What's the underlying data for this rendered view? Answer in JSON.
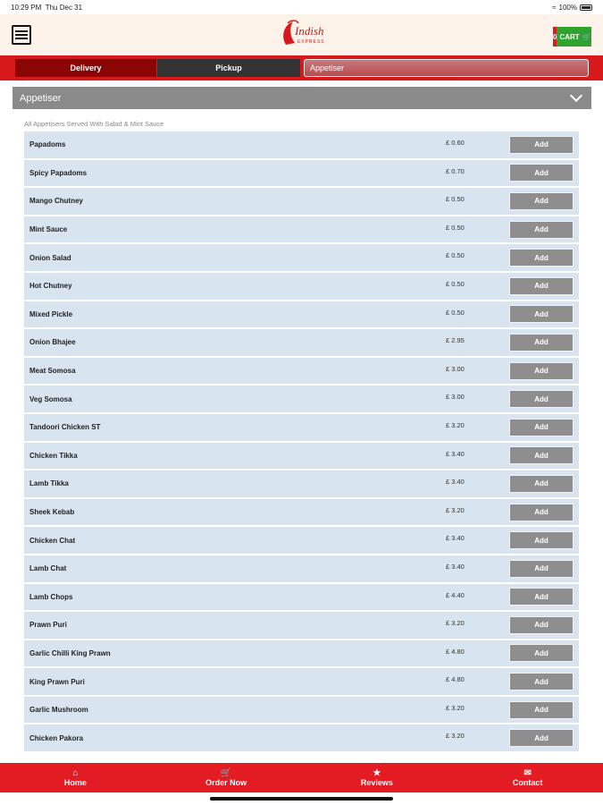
{
  "status_bar": {
    "time": "10:29 PM",
    "date": "Thu Dec 31",
    "battery": "100%"
  },
  "header": {
    "logo_text": "Indish",
    "logo_sub": "EXPRESS",
    "cart_count": "0",
    "cart_label": "CART"
  },
  "tabs": {
    "delivery": "Delivery",
    "pickup": "Pickup",
    "category_selected": "Appetiser"
  },
  "section": {
    "title": "Appetiser",
    "note": "All Appetisers Served With Salad & Mint Sauce"
  },
  "items": [
    {
      "name": "Papadoms",
      "price": "£ 0.60",
      "action": "Add"
    },
    {
      "name": "Spicy Papadoms",
      "price": "£ 0.70",
      "action": "Add"
    },
    {
      "name": "Mango Chutney",
      "price": "£ 0.50",
      "action": "Add"
    },
    {
      "name": "Mint Sauce",
      "price": "£ 0.50",
      "action": "Add"
    },
    {
      "name": "Onion Salad",
      "price": "£ 0.50",
      "action": "Add"
    },
    {
      "name": "Hot Chutney",
      "price": "£ 0.50",
      "action": "Add"
    },
    {
      "name": "Mixed Pickle",
      "price": "£ 0.50",
      "action": "Add"
    },
    {
      "name": "Onion Bhajee",
      "price": "£ 2.95",
      "action": "Add"
    },
    {
      "name": "Meat Somosa",
      "price": "£ 3.00",
      "action": "Add"
    },
    {
      "name": "Veg Somosa",
      "price": "£ 3.00",
      "action": "Add"
    },
    {
      "name": "Tandoori Chicken ST",
      "price": "£ 3.20",
      "action": "Add"
    },
    {
      "name": "Chicken Tikka",
      "price": "£ 3.40",
      "action": "Add"
    },
    {
      "name": "Lamb Tikka",
      "price": "£ 3.40",
      "action": "Add"
    },
    {
      "name": "Sheek Kebab",
      "price": "£ 3.20",
      "action": "Add"
    },
    {
      "name": "Chicken Chat",
      "price": "£ 3.40",
      "action": "Add"
    },
    {
      "name": "Lamb Chat",
      "price": "£ 3.40",
      "action": "Add"
    },
    {
      "name": "Lamb Chops",
      "price": "£ 4.40",
      "action": "Add"
    },
    {
      "name": "Prawn Puri",
      "price": "£ 3.20",
      "action": "Add"
    },
    {
      "name": "Garlic Chilli King Prawn",
      "price": "£ 4.80",
      "action": "Add"
    },
    {
      "name": "King Prawn Puri",
      "price": "£ 4.80",
      "action": "Add"
    },
    {
      "name": "Garlic Mushroom",
      "price": "£ 3.20",
      "action": "Add"
    },
    {
      "name": "Chicken Pakora",
      "price": "£ 3.20",
      "action": "Add"
    }
  ],
  "footer": [
    {
      "label": "Home",
      "icon": "home-icon"
    },
    {
      "label": "Order Now",
      "icon": "cart-icon"
    },
    {
      "label": "Reviews",
      "icon": "star-icon"
    },
    {
      "label": "Contact",
      "icon": "envelope-icon"
    }
  ],
  "colors": {
    "brand_red": "#e31b23",
    "add_button": "#8e8e8e",
    "row_bg": "#d8e4ef",
    "cart_green": "#2ea32e"
  }
}
